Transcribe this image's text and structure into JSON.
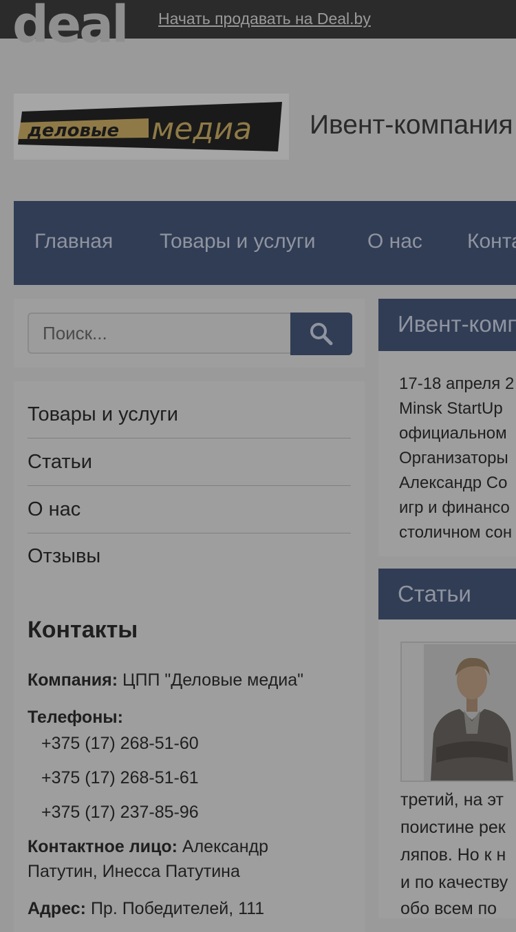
{
  "topbar": {
    "logo_text": "deal",
    "sell_link": "Начать продавать на Deal.by"
  },
  "header": {
    "brand_logo_text_left": "деловые",
    "brand_logo_text_right": "медиа",
    "company_title": "Ивент-компания"
  },
  "nav": {
    "items": [
      {
        "label": "Главная"
      },
      {
        "label": "Товары и услуги"
      },
      {
        "label": "О нас"
      },
      {
        "label": "Контакты"
      }
    ]
  },
  "search": {
    "placeholder": "Поиск..."
  },
  "sidebar": {
    "menu": [
      {
        "label": "Товары и услуги"
      },
      {
        "label": "Статьи"
      },
      {
        "label": "О нас"
      },
      {
        "label": "Отзывы"
      }
    ],
    "contacts": {
      "heading": "Контакты",
      "company_label": "Компания:",
      "company_value": "ЦПП \"Деловые медиа\"",
      "phones_label": "Телефоны:",
      "phones": [
        "+375 (17) 268-51-60",
        "+375 (17) 268-51-61",
        "+375 (17) 237-85-96"
      ],
      "person_label": "Контактное лицо:",
      "person_value_1": "Александр",
      "person_value_2": "Патутин, Инесса Патутина",
      "address_label": "Адрес:",
      "address_value": "Пр. Победителей, 111"
    }
  },
  "main": {
    "event_heading": "Ивент-компания",
    "event_lines": [
      "17-18 апреля 2",
      "Minsk StartUp",
      "официальном",
      "Организаторы",
      "Александр Со",
      "игр и финансо",
      "столичном сон"
    ],
    "articles_heading": "Статьи",
    "article_lines": [
      "третий, на эт",
      "поистине рек",
      "ляпов. Но к н",
      "и по качеству",
      "обо всем по"
    ]
  },
  "colors": {
    "topbar": "#2b2b2b",
    "accent_navy": "#313d55",
    "overlay_gray": "#9a9a9a"
  }
}
